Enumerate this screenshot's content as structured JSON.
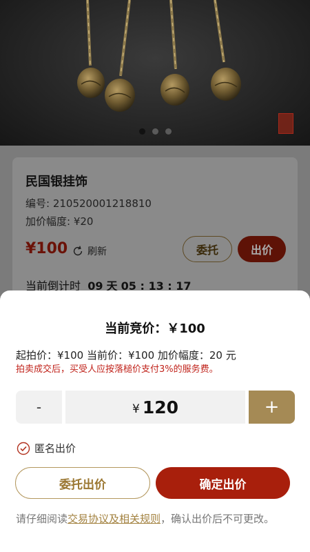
{
  "carousel": {
    "slide_count": 3,
    "active_index": 0
  },
  "product": {
    "title": "民国银挂饰",
    "serial_label": "编号: 210520001218810",
    "increment_label": "加价幅度: ¥20",
    "price": "¥100",
    "refresh_label": "刷新",
    "entrust_button": "委托",
    "bid_button": "出价",
    "countdown_label": "当前倒计时",
    "countdown_days": "09",
    "countdown_day_unit": "天",
    "countdown_time": "05 : 13 : 17"
  },
  "sheet": {
    "title": "当前竞价：￥100",
    "info": "起拍价：¥100 当前价：¥100 加价幅度：20 元",
    "warning": "拍卖成交后，买受人应按落槌价支付3%的服务费。",
    "minus_label": "-",
    "currency_symbol": "¥",
    "bid_amount": "120",
    "plus_label": "+",
    "anonymous_label": "匿名出价",
    "anonymous_checked": true,
    "entrust_bid_button": "委托出价",
    "confirm_bid_button": "确定出价",
    "notice_prefix": "请仔细阅读",
    "notice_link": "交易协议及相关规则",
    "notice_suffix": "，确认出价后不可更改。"
  },
  "colors": {
    "accent_red": "#a81f0c",
    "accent_gold": "#a58a55",
    "warning_red": "#c0221a"
  }
}
